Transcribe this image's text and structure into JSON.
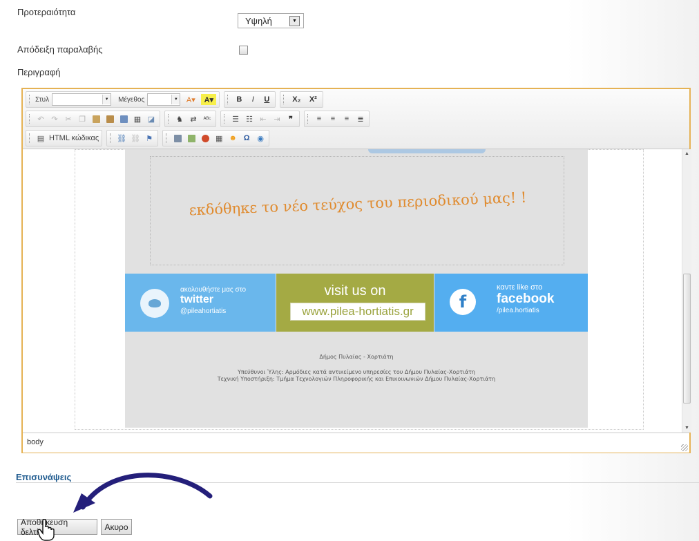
{
  "form": {
    "priority_label": "Προτεραιότητα",
    "priority_value": "Υψηλή",
    "receipt_label": "Απόδειξη παραλαβής",
    "description_label": "Περιγραφή"
  },
  "toolbar": {
    "style_label": "Στυλ",
    "size_label": "Μέγεθος",
    "bold": "B",
    "italic": "I",
    "underline": "U",
    "subscript": "X₂",
    "superscript": "X²",
    "html_code_label": "HTML κώδικας"
  },
  "content": {
    "headline": "εκδόθηκε το νέο τεύχος του περιοδικού μας! !",
    "twitter_line1": "ακολουθήστε μας στο",
    "twitter_brand": "twitter",
    "twitter_handle": "@pileahortiatis",
    "visit_text": "visit us on",
    "visit_url": "www.pilea-hortiatis.gr",
    "fb_line1": "καντε like στο",
    "fb_brand": "facebook",
    "fb_handle": "/pilea.hortiatis",
    "footer_title": "Δήμος Πυλαίας - Χορτιάτη",
    "footer_line1": "Υπεύθυνοι Ύλης: Αρμόδιες κατά αντικείμενο υπηρεσίες του Δήμου Πυλαίας-Χορτιάτη",
    "footer_line2": "Τεχνική Υποστήριξη: Τμήμα Τεχνολογιών Πληροφορικής και Επικοινωνιών Δήμου Πυλαίας-Χορτιάτη"
  },
  "status": {
    "path": "body"
  },
  "attachments": {
    "title": "Επισυνάψεις"
  },
  "buttons": {
    "save": "Αποθήκευση δελτίου",
    "cancel": "Ακυρο"
  },
  "colors": {
    "editor_border": "#e5b254",
    "headline": "#e08b2f",
    "attach_title": "#1f5b8f"
  }
}
